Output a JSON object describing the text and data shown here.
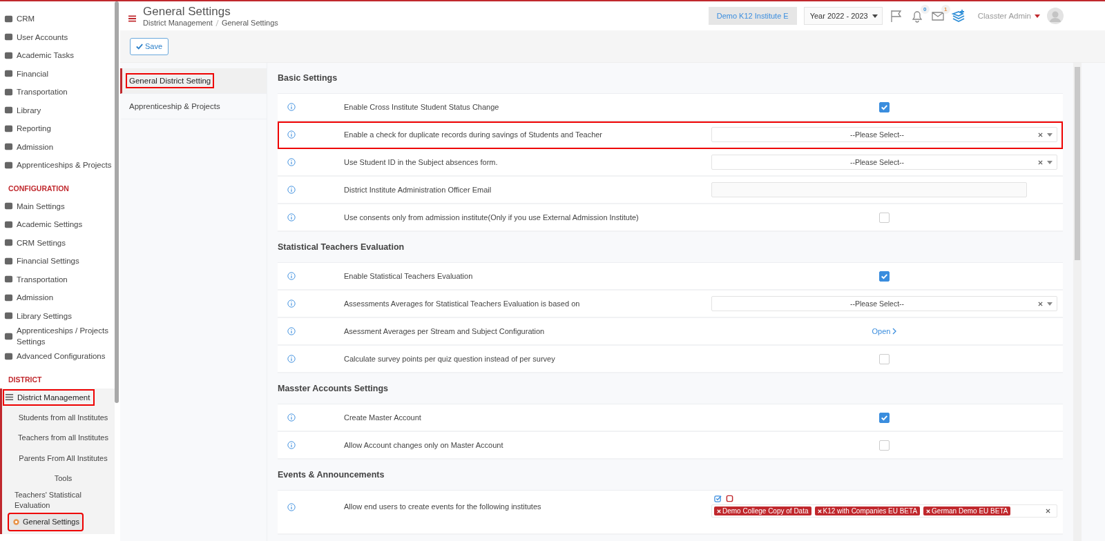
{
  "sidebar": {
    "groups": [
      {
        "items": [
          {
            "label": "CRM",
            "highlighted": false
          },
          {
            "label": "User Accounts",
            "highlighted": false
          },
          {
            "label": "Academic Tasks",
            "highlighted": false
          },
          {
            "label": "Financial",
            "highlighted": false
          },
          {
            "label": "Transportation",
            "highlighted": false
          },
          {
            "label": "Library",
            "highlighted": false
          },
          {
            "label": "Reporting",
            "highlighted": false
          },
          {
            "label": "Admission",
            "highlighted": false
          },
          {
            "label": "Apprenticeships & Projects",
            "highlighted": false
          }
        ]
      },
      {
        "heading": "CONFIGURATION",
        "items": [
          {
            "label": "Main Settings",
            "highlighted": false
          },
          {
            "label": "Academic Settings",
            "highlighted": false
          },
          {
            "label": "CRM Settings",
            "highlighted": false
          },
          {
            "label": "Financial Settings",
            "highlighted": false
          },
          {
            "label": "Transportation",
            "highlighted": false
          },
          {
            "label": "Admission",
            "highlighted": false
          },
          {
            "label": "Library Settings",
            "highlighted": false
          },
          {
            "label": "Apprenticeships / Projects Settings",
            "highlighted": false
          },
          {
            "label": "Advanced Configurations",
            "highlighted": false
          }
        ]
      },
      {
        "heading": "DISTRICT",
        "items": [
          {
            "label": "District Management",
            "highlighted": true,
            "expanded": true,
            "children": [
              {
                "label": "Students from all Institutes",
                "selected": false,
                "highlighted": false
              },
              {
                "label": "Teachers from all Institutes",
                "selected": false,
                "highlighted": false
              },
              {
                "label": "Parents From All Institutes",
                "selected": false,
                "highlighted": false
              },
              {
                "label": "Tools",
                "selected": false,
                "highlighted": false
              },
              {
                "label": "Teachers' Statistical Evaluation",
                "selected": false,
                "highlighted": false
              },
              {
                "label": "General Settings",
                "selected": true,
                "highlighted": true
              }
            ]
          }
        ]
      }
    ]
  },
  "header": {
    "title": "General Settings",
    "breadcrumb": [
      "District Management",
      "General Settings"
    ],
    "institute": "Demo K12 Institute E",
    "year": "Year 2022 - 2023",
    "notifications": "0",
    "messages": "1",
    "user": "Classter Admin"
  },
  "toolbar": {
    "save": "Save"
  },
  "tabs": [
    {
      "label": "General District Setting",
      "selected": true,
      "highlighted": true
    },
    {
      "label": "Apprenticeship & Projects",
      "selected": false,
      "highlighted": false
    }
  ],
  "sections": [
    {
      "title": "Basic Settings",
      "rows": [
        {
          "kind": "checkbox",
          "label": "Enable Cross Institute Student Status Change",
          "checked": true,
          "highlighted": false
        },
        {
          "kind": "select",
          "label": "Enable a check for duplicate records during savings of Students and Teacher",
          "placeholder": "--Please Select--",
          "highlighted": true
        },
        {
          "kind": "select",
          "label": "Use Student ID in the Subject absences form.",
          "placeholder": "--Please Select--",
          "highlighted": false
        },
        {
          "kind": "text",
          "label": "District Institute Administration Officer Email",
          "highlighted": false
        },
        {
          "kind": "checkbox",
          "label": "Use consents only from admission institute(Only if you use External Admission Institute)",
          "checked": false,
          "highlighted": false
        }
      ]
    },
    {
      "title": "Statistical Teachers Evaluation",
      "rows": [
        {
          "kind": "checkbox",
          "label": "Enable Statistical Teachers Evaluation",
          "checked": true,
          "highlighted": false
        },
        {
          "kind": "select",
          "label": "Assessments Averages for Statistical Teachers Evaluation is based on",
          "placeholder": "--Please Select--",
          "highlighted": false
        },
        {
          "kind": "link",
          "label": "Asessment Averages per Stream and Subject Configuration",
          "link": "Open",
          "highlighted": false
        },
        {
          "kind": "checkbox",
          "label": "Calculate survey points per quiz question instead of per survey",
          "checked": false,
          "highlighted": false
        }
      ]
    },
    {
      "title": "Masster Accounts Settings",
      "rows": [
        {
          "kind": "checkbox",
          "label": "Create Master Account",
          "checked": true,
          "highlighted": false
        },
        {
          "kind": "checkbox",
          "label": "Allow Account changes only on Master Account",
          "checked": false,
          "highlighted": false
        }
      ]
    },
    {
      "title": "Events & Announcements",
      "rows": [
        {
          "kind": "multiselect",
          "label": "Allow end users to create events for the following institutes",
          "tags": [
            "Demo College Copy of Data",
            "K12 with Companies EU BETA",
            "German Demo EU BETA"
          ],
          "highlighted": false
        }
      ]
    }
  ]
}
